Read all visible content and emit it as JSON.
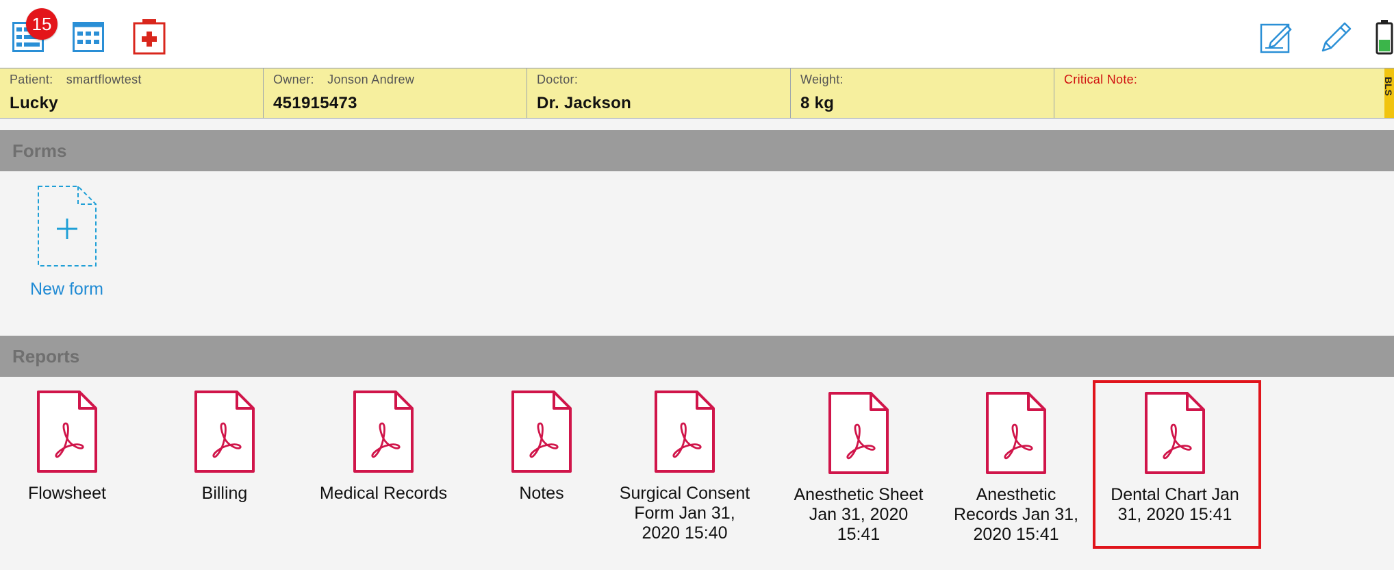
{
  "toolbar": {
    "badge_count": "15",
    "icons": [
      "list-icon",
      "grid-icon",
      "medical-kit-icon",
      "edit-note-icon",
      "pencil-icon",
      "battery-icon"
    ],
    "colors": {
      "blue": "#2a8fd6",
      "red": "#d9261c",
      "badge": "#e3151a",
      "battery_fill": "#3bb54a"
    }
  },
  "patient": {
    "patient_label": "Patient:",
    "patient_sub": "smartflowtest",
    "patient_name": "Lucky",
    "owner_label": "Owner:",
    "owner_sub": "Jonson Andrew",
    "owner_id": "451915473",
    "doctor_label": "Doctor:",
    "doctor_name": "Dr. Jackson",
    "weight_label": "Weight:",
    "weight_value": "8 kg",
    "critical_label": "Critical Note:",
    "critical_value": "",
    "side_tab": "BLS"
  },
  "forms": {
    "header": "Forms",
    "new_form_label": "New form"
  },
  "reports": {
    "header": "Reports",
    "items": [
      {
        "line1": "Flowsheet",
        "line2": "",
        "line3": ""
      },
      {
        "line1": "Billing",
        "line2": "",
        "line3": ""
      },
      {
        "line1": "Medical Records",
        "line2": "",
        "line3": ""
      },
      {
        "line1": "Notes",
        "line2": "",
        "line3": ""
      },
      {
        "line1": "Surgical Consent",
        "line2": "Form Jan 31,",
        "line3": "2020 15:40"
      },
      {
        "line1": "Anesthetic Sheet",
        "line2": "Jan 31, 2020",
        "line3": "15:41"
      },
      {
        "line1": "Anesthetic",
        "line2": "Records Jan 31,",
        "line3": "2020 15:41"
      },
      {
        "line1": "Dental Chart Jan",
        "line2": "31, 2020 15:41",
        "line3": ""
      }
    ],
    "selected_index": 7,
    "pdf_color": "#d0154a"
  }
}
